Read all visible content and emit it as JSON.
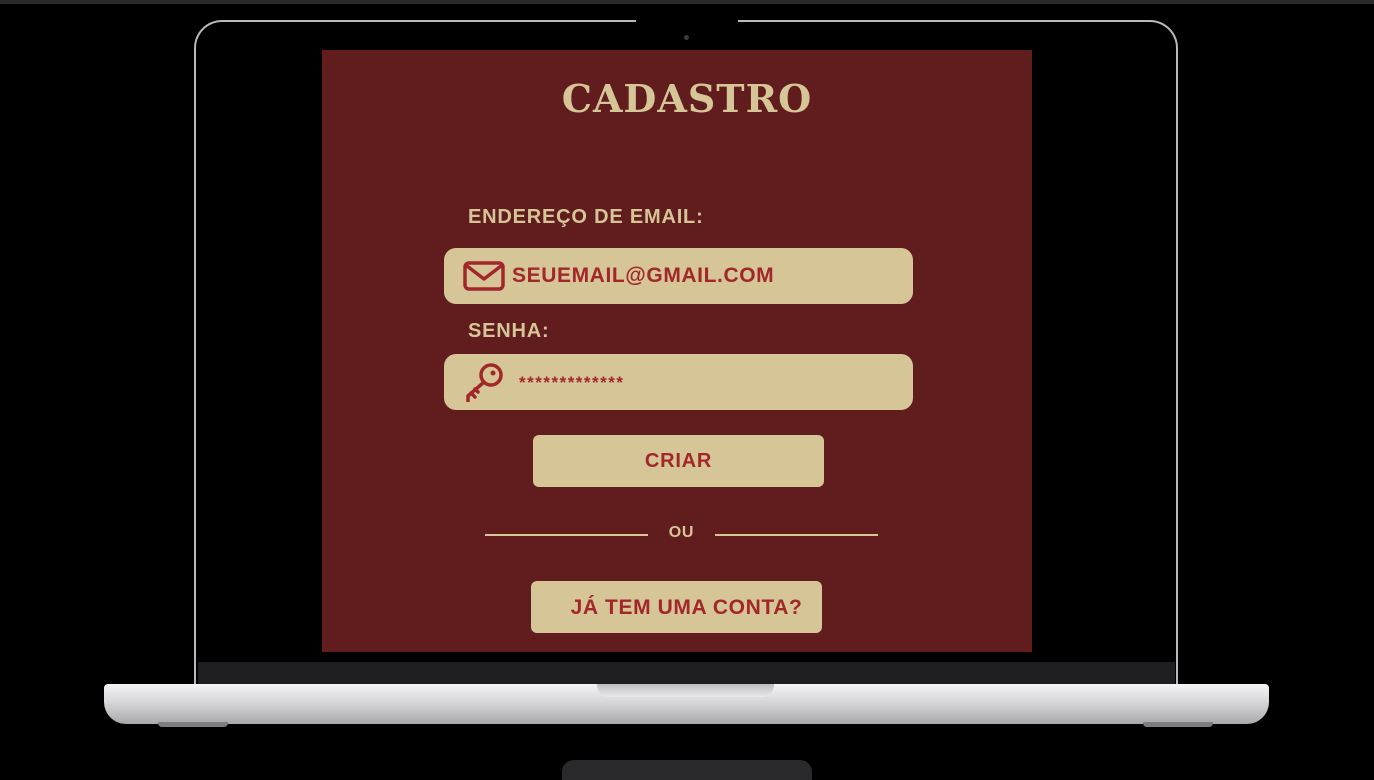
{
  "colors": {
    "screen_background": "#611c1e",
    "accent_beige": "#d5c597",
    "text_red": "#a2272b"
  },
  "signup": {
    "title": "CADASTRO",
    "email_label": "ENDEREÇO DE EMAIL:",
    "email_value": "SEUEMAIL@GMAIL.COM",
    "email_icon": "mail-icon",
    "password_label": "SENHA:",
    "password_value": "*************",
    "password_icon": "key-icon",
    "create_button": "CRIAR",
    "divider_text": "OU",
    "existing_account_button": "JÁ TEM UMA CONTA?"
  }
}
